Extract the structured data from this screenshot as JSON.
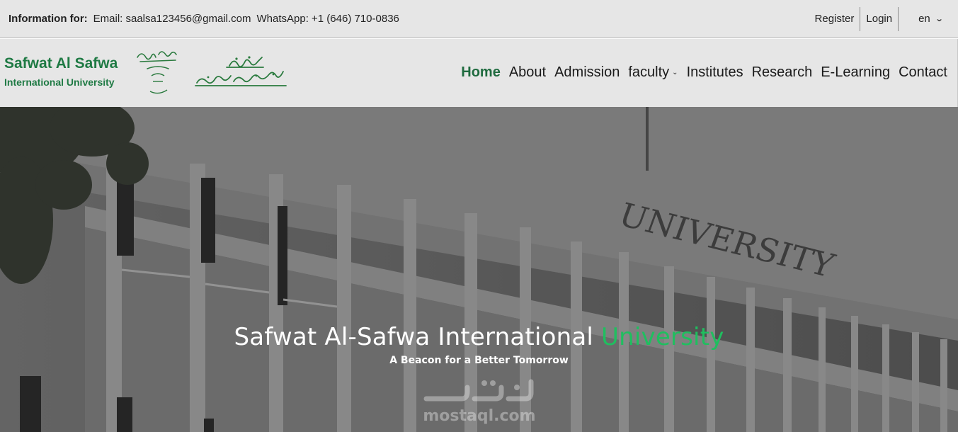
{
  "topbar": {
    "info_label": "Information for:",
    "email": "Email: saalsa123456@gmail.com",
    "whatsapp": "WhatsApp: +1 (646) 710-0836",
    "register": "Register",
    "login": "Login",
    "language": "en",
    "language_icon": "chevron-down-icon"
  },
  "logo": {
    "name_line1": "Safwat Al Safwa",
    "name_line2": "International University",
    "brand_color": "#1f7a44"
  },
  "nav": {
    "items": [
      {
        "label": "Home",
        "active": true
      },
      {
        "label": "About"
      },
      {
        "label": "Admission"
      },
      {
        "label": "faculty",
        "has_dropdown": true
      },
      {
        "label": "Institutes"
      },
      {
        "label": "Research"
      },
      {
        "label": "E-Learning"
      },
      {
        "label": "Contact"
      }
    ],
    "active_color": "#1f6b3f"
  },
  "hero": {
    "title_main": "Safwat Al-Safwa International ",
    "title_accent": "University",
    "subtitle": "A Beacon for a Better Tomorrow",
    "building_sign": "UNIVERSITY",
    "accent_color": "#1fbf5f",
    "watermark": "mostaql.com"
  }
}
